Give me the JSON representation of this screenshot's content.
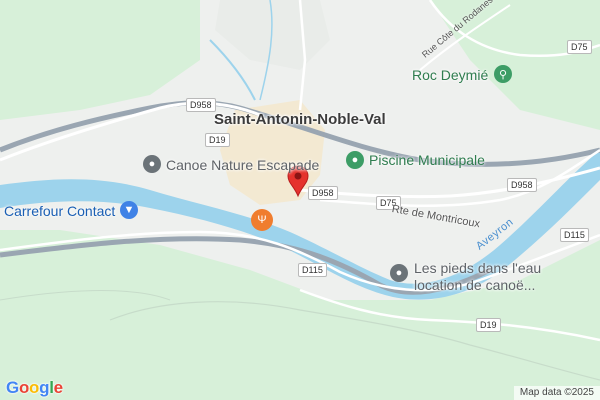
{
  "map": {
    "town": "Saint-Antonin-Noble-Val",
    "pois": {
      "canoe_nature": "Canoe Nature Escapade",
      "piscine": "Piscine Municipale",
      "roc_deymie": "Roc Deymié",
      "carrefour": "Carrefour Contact",
      "pieds_line1": "Les pieds dans l'eau",
      "pieds_line2": "location de canoë..."
    },
    "streets": {
      "rte_montricoux": "Rte de Montricoux",
      "rue_cote_rodanes": "Rue Côte du Rodanes"
    },
    "river": "Aveyron",
    "road_shields": {
      "d958_west": "D958",
      "d19_north": "D19",
      "d958_town": "D958",
      "d75_east": "D75",
      "d75_north": "D75",
      "d958_east": "D958",
      "d115_east": "D115",
      "d115_south": "D115",
      "d19_south": "D19"
    },
    "colors": {
      "river": "#9dd3ec",
      "forest": "#d7f0d9",
      "land": "#eef0ee",
      "road": "#ffffff",
      "pin": "#e5322d",
      "accent_orange": "#f07d2e"
    }
  },
  "footer": {
    "logo_letters": [
      "G",
      "o",
      "o",
      "g",
      "l",
      "e"
    ],
    "attribution": "Map data ©2025"
  }
}
